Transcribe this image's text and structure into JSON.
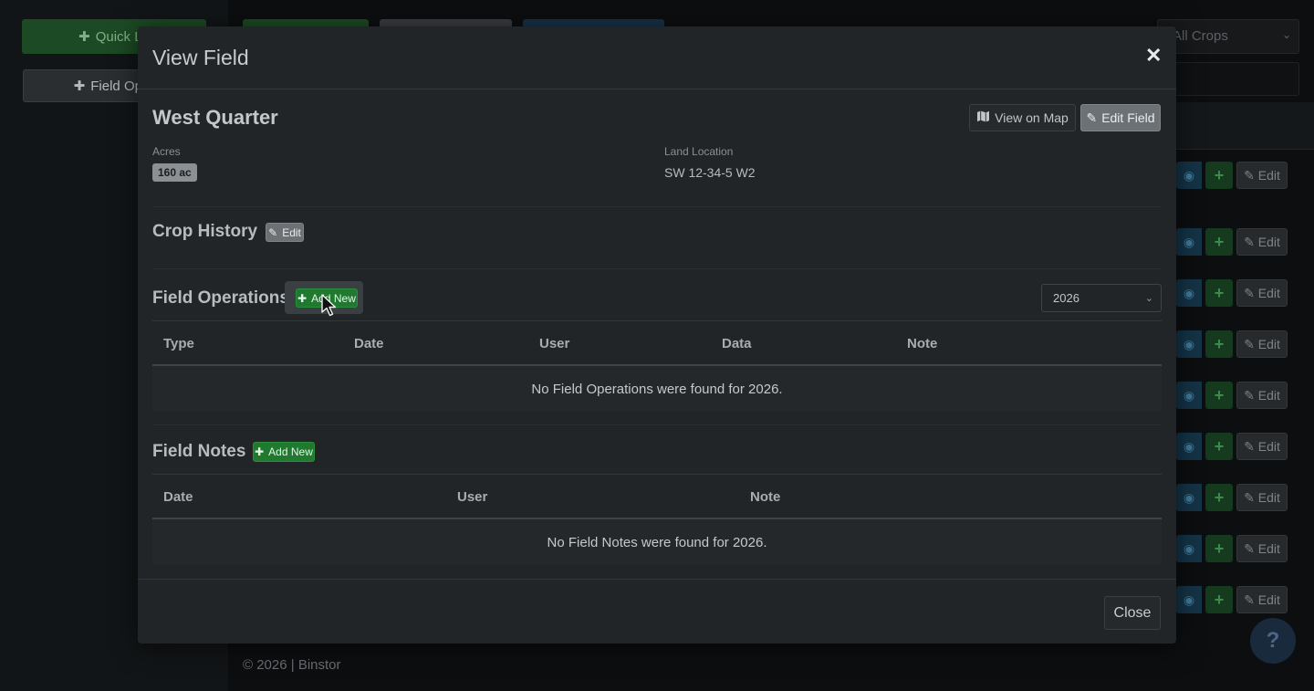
{
  "background": {
    "sidebar": {
      "quick_label": "Quick Lo",
      "field_ops_label": "Field Oper"
    },
    "crop_filter": "All Crops",
    "row_edit_label": "Edit",
    "footer": "© 2026 | Binstor",
    "help_label": "?"
  },
  "modal": {
    "title": "View Field",
    "close_symbol": "✕",
    "field_name": "West Quarter",
    "view_on_map_label": "View on Map",
    "edit_field_label": "Edit Field",
    "acres_label": "Acres",
    "acres_value": "160 ac",
    "land_location_label": "Land Location",
    "land_location_value": "SW 12-34-5 W2",
    "crop_history": {
      "title": "Crop History",
      "edit_label": "Edit"
    },
    "field_operations": {
      "title": "Field Operations",
      "add_label": "Add New",
      "year": "2026",
      "columns": [
        "Type",
        "Date",
        "User",
        "Data",
        "Note"
      ],
      "empty_text": "No Field Operations were found for 2026."
    },
    "field_notes": {
      "title": "Field Notes",
      "add_label": "Add New",
      "columns": [
        "Date",
        "User",
        "Note"
      ],
      "empty_text": "No Field Notes were found for 2026."
    },
    "close_button": "Close"
  },
  "colors": {
    "accent_green": "#1f7a2f",
    "modal_bg": "#222528",
    "page_bg": "#0f1214"
  }
}
